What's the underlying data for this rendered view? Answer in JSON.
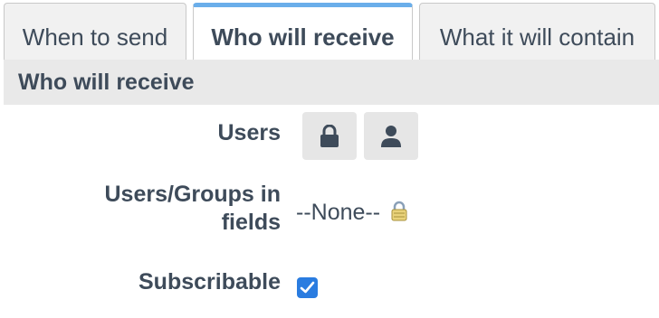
{
  "tabs": [
    {
      "label": "When to send",
      "active": false
    },
    {
      "label": "Who will receive",
      "active": true
    },
    {
      "label": "What it will contain",
      "active": false
    }
  ],
  "section": {
    "title": "Who will receive"
  },
  "fields": {
    "users": {
      "label": "Users",
      "buttons": [
        "lock-icon",
        "user-icon"
      ]
    },
    "users_groups": {
      "label_line1": "Users/Groups in",
      "label_line2": "fields",
      "value": "--None--"
    },
    "subscribable": {
      "label": "Subscribable",
      "checked": true
    }
  },
  "colors": {
    "accent": "#6aaeea",
    "checkbox": "#2a7ce0"
  }
}
